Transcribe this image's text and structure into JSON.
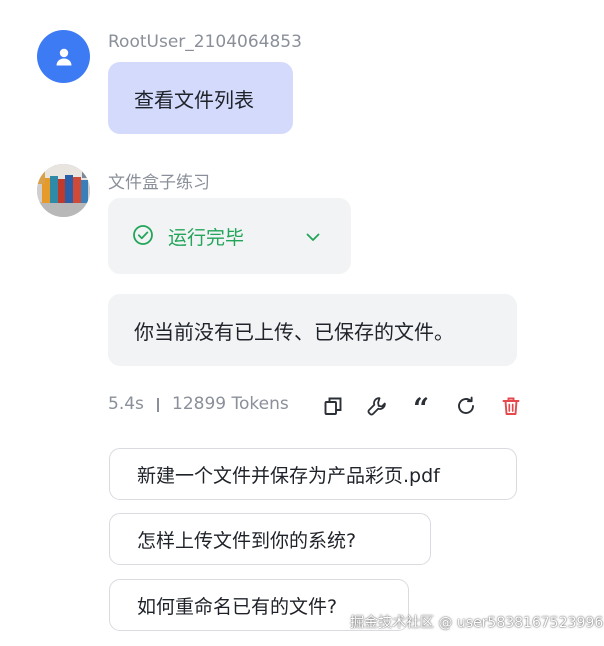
{
  "user_message": {
    "username": "RootUser_2104064853",
    "text": "查看文件列表",
    "avatar_icon": "person-icon"
  },
  "bot_message": {
    "name": "文件盒子练习",
    "avatar_icon": "binders-image",
    "status": {
      "text": "运行完毕",
      "icon": "check-circle-icon",
      "expand_icon": "chevron-down-icon"
    },
    "reply": "你当前没有已上传、已保存的文件。",
    "meta": {
      "duration": "5.4s",
      "tokens": "12899 Tokens"
    },
    "actions": [
      "copy-icon",
      "wrench-icon",
      "quote-icon",
      "refresh-icon",
      "delete-icon"
    ]
  },
  "suggestions": [
    "新建一个文件并保存为产品彩页.pdf",
    "怎样上传文件到你的系统?",
    "如何重命名已有的文件?"
  ],
  "watermark": "掘金技术社区 @ user5838167523996",
  "colors": {
    "user_avatar": "#3d7bf5",
    "user_bubble": "#d3dafc",
    "bot_bubble": "#f2f3f5",
    "status_green": "#22a559",
    "delete_red": "#e5484d",
    "muted_text": "#8a8f99"
  }
}
